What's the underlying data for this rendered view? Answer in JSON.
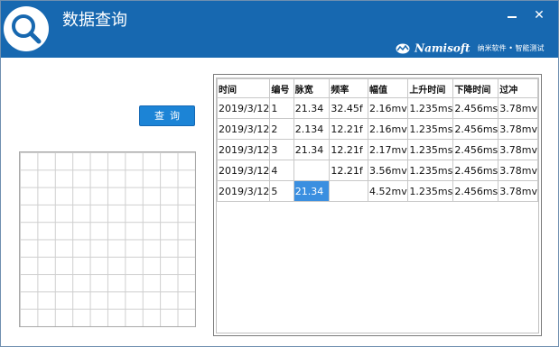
{
  "window": {
    "title": "数据查询",
    "minimize_label": "",
    "close_label": "✕",
    "brand_name": "Namisoft",
    "brand_tagline": "纳米软件 • 智能测试",
    "accent_color": "#1768b0"
  },
  "icons": {
    "app": "search-icon",
    "brand": "namisoft-logo-icon"
  },
  "query_button": {
    "label": "查询"
  },
  "table": {
    "columns": [
      "时间",
      "编号",
      "脉宽",
      "频率",
      "幅值",
      "上升时间",
      "下降时间",
      "过冲"
    ],
    "rows": [
      [
        "2019/3/12",
        "1",
        "21.34",
        "32.45f",
        "2.16mv",
        "1.235ms",
        "2.456ms",
        "3.78mv"
      ],
      [
        "2019/3/12",
        "2",
        "2.134",
        "12.21f",
        "2.16mv",
        "1.235ms",
        "2.456ms",
        "3.78mv"
      ],
      [
        "2019/3/12",
        "3",
        "21.34",
        "12.21f",
        "2.17mv",
        "1.235ms",
        "2.456ms",
        "3.78mv"
      ],
      [
        "2019/3/12",
        "4",
        "",
        "12.21f",
        "3.56mv",
        "1.235ms",
        "2.456ms",
        "3.78mv"
      ],
      [
        "2019/3/12",
        "5",
        "21.34",
        "",
        "4.52mv",
        "1.235ms",
        "2.456ms",
        "3.78mv"
      ]
    ],
    "selected_cell": {
      "row": 4,
      "col": 2
    }
  }
}
